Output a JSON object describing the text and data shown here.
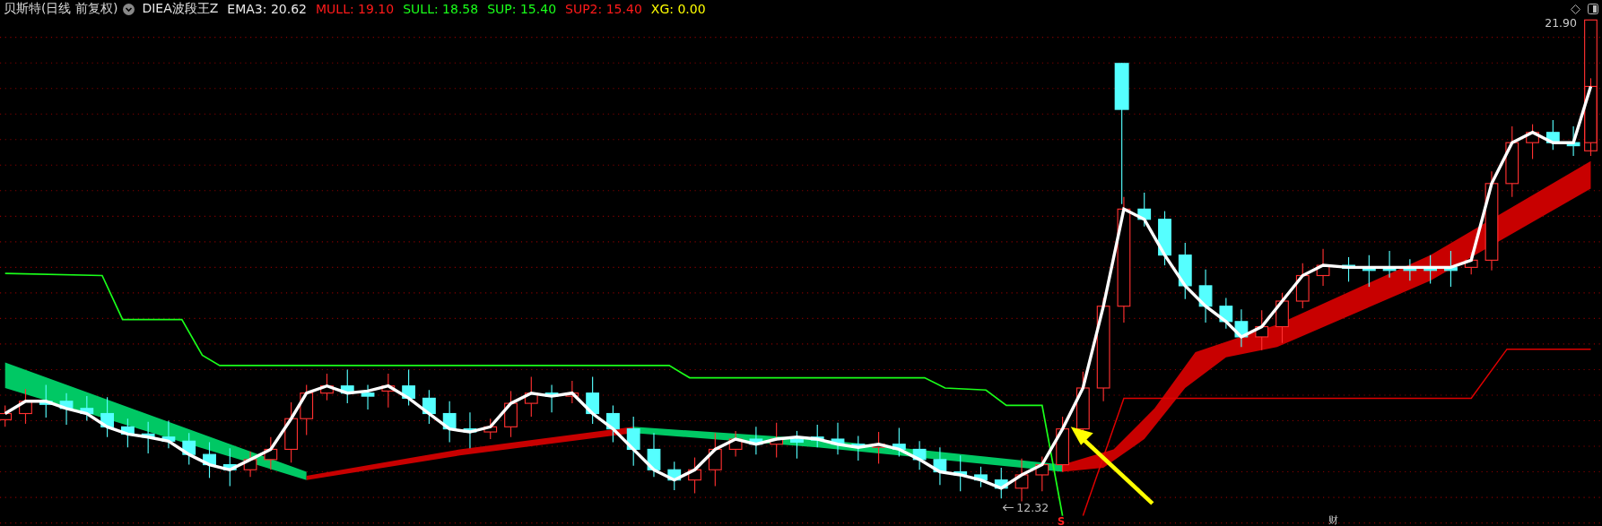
{
  "header": {
    "title": "贝斯特(日线 前复权)",
    "indicator": "DIEA波段王Z",
    "readings": [
      {
        "label": "EMA3:",
        "value": "20.62",
        "color": "#e8e8e8"
      },
      {
        "label": "MULL:",
        "value": "19.10",
        "color": "#ff1a1a"
      },
      {
        "label": "SULL:",
        "value": "18.58",
        "color": "#1aff1a"
      },
      {
        "label": "SUP:",
        "value": "15.40",
        "color": "#1aff1a"
      },
      {
        "label": "SUP2:",
        "value": "15.40",
        "color": "#ff1a1a"
      },
      {
        "label": "XG:",
        "value": "0.00",
        "color": "#ffff00"
      }
    ]
  },
  "chart": {
    "high_label": "21.90",
    "low_label": "12.32",
    "signal": "S",
    "badge": "财"
  }
}
